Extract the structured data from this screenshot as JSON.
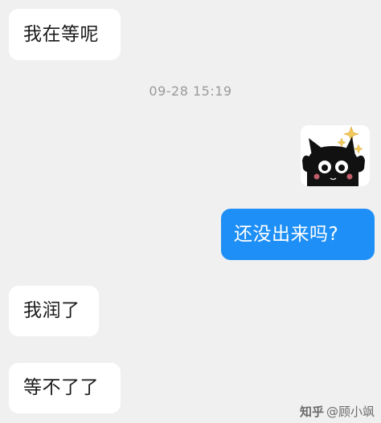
{
  "chat": {
    "messages": [
      {
        "side": "left",
        "text": "我在等呢"
      },
      {
        "side": "right",
        "text": "还没出来吗?"
      },
      {
        "side": "left",
        "text": "我润了"
      },
      {
        "side": "left",
        "text": "等不了了"
      }
    ],
    "timestamp": "09-28 15:19",
    "sticker": {
      "icon": "black-cat-sparkle-sticker"
    }
  },
  "watermark": {
    "logo": "知乎",
    "handle": "@顾小飒"
  },
  "colors": {
    "background": "#f0f0f0",
    "incoming_bubble": "#ffffff",
    "outgoing_bubble": "#1e8ff6"
  }
}
